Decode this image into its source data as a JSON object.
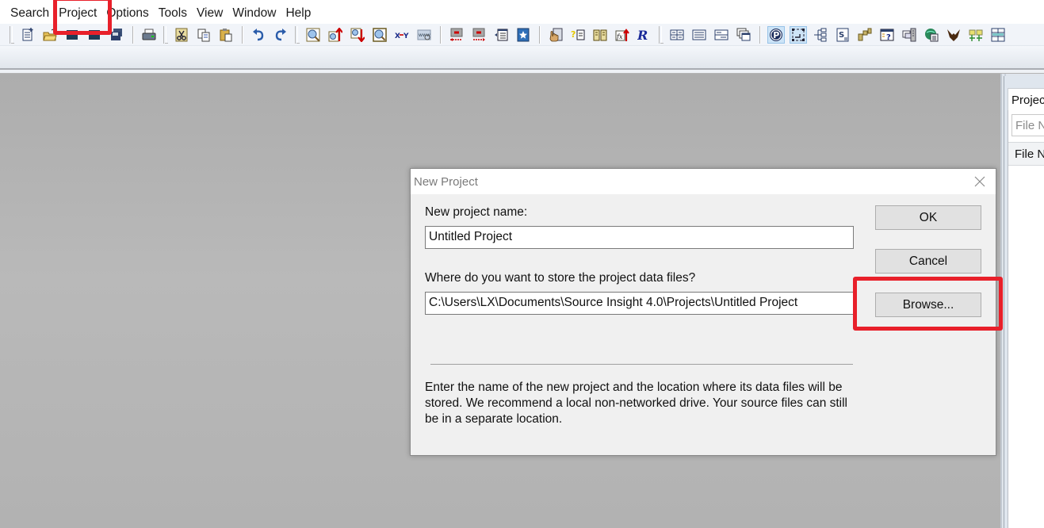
{
  "menubar": {
    "items": [
      {
        "label": "Search"
      },
      {
        "label": "Project"
      },
      {
        "label": "Options"
      },
      {
        "label": "Tools"
      },
      {
        "label": "View"
      },
      {
        "label": "Window"
      },
      {
        "label": "Help"
      }
    ]
  },
  "toolbar": {
    "groups": [
      [
        "new-file-icon",
        "open-folder-icon",
        "save-icon",
        "save-as-icon",
        "save-all-icon"
      ],
      [
        "print-icon"
      ],
      [
        "cut-icon",
        "copy-icon",
        "paste-icon"
      ],
      [
        "undo-icon",
        "redo-icon"
      ],
      [
        "search-icon",
        "search-backward-icon",
        "search-forward-icon",
        "search-files-icon",
        "replace-icon",
        "search-web-icon"
      ],
      [
        "go-back-icon",
        "go-forward-icon",
        "jump-to-list-icon",
        "bookmark-icon"
      ],
      [
        "symbol-lookup-icon",
        "symbol-info-icon",
        "browse-book-icon",
        "function-up-icon",
        "relation-icon"
      ],
      [
        "layout-split-icon",
        "layout-list-icon",
        "layout-detail-icon",
        "cascade-windows-icon"
      ],
      [
        "project-window-icon",
        "context-window-icon",
        "symbol-tree-icon",
        "source-icon",
        "call-graph-icon",
        "help-panel-icon",
        "file-compare-icon",
        "globe-icon",
        "bird-icon",
        "sync-icon",
        "grid-view-icon"
      ]
    ],
    "pressed": [
      "project-window-icon",
      "context-window-icon"
    ]
  },
  "right_panel": {
    "tab_label": "Project",
    "search_placeholder": "File Name",
    "column_header": "File Name"
  },
  "dialog": {
    "title": "New Project",
    "name_label": "New project name:",
    "name_value": "Untitled Project",
    "location_label": "Where do you want to store the project data files?",
    "location_value": "C:\\Users\\LX\\Documents\\Source Insight 4.0\\Projects\\Untitled Project",
    "ok_label": "OK",
    "cancel_label": "Cancel",
    "browse_label": "Browse...",
    "description": "Enter the name of the new project and the location where its data files will be stored. We recommend a local non-networked drive. Your source files can still be in a separate location."
  },
  "annotations": {
    "highlight_color": "#e8202a",
    "highlighted": [
      "menu-project",
      "browse-button"
    ]
  }
}
